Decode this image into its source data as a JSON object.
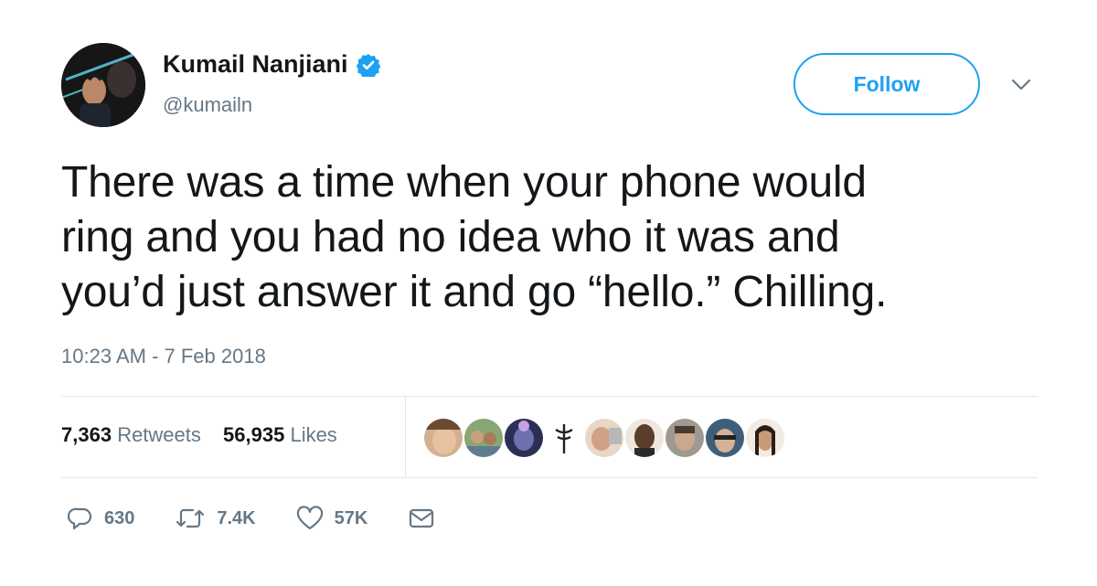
{
  "user": {
    "display_name": "Kumail Nanjiani",
    "handle": "@kumailn"
  },
  "follow_label": "Follow",
  "tweet": {
    "lines": [
      "There was a time when your phone would",
      "ring and you had no idea who it was and",
      "you’d just answer it and go “hello.” Chilling."
    ],
    "timestamp": "10:23 AM - 7 Feb 2018"
  },
  "stats": {
    "retweets_count": "7,363",
    "retweets_label": "Retweets",
    "likes_count": "56,935",
    "likes_label": "Likes"
  },
  "actions": {
    "reply_count": "630",
    "retweet_count": "7.4K",
    "like_count": "57K"
  },
  "colors": {
    "accent": "#1da1f2",
    "muted": "#657786",
    "text": "#14171a",
    "divider": "#e1e8ed"
  },
  "likers": [
    {
      "icon": "liker-avatar-1",
      "color": "#c9a48a"
    },
    {
      "icon": "liker-avatar-2",
      "color": "#7f9a6b"
    },
    {
      "icon": "liker-avatar-3",
      "color": "#4a4f7a"
    },
    {
      "icon": "liker-avatar-4",
      "color": "#ffffff"
    },
    {
      "icon": "liker-avatar-5",
      "color": "#d8b49a"
    },
    {
      "icon": "liker-avatar-6",
      "color": "#5a3d2b"
    },
    {
      "icon": "liker-avatar-7",
      "color": "#8c8c84"
    },
    {
      "icon": "liker-avatar-8",
      "color": "#3e5f7a"
    },
    {
      "icon": "liker-avatar-9",
      "color": "#e6dcd2"
    }
  ]
}
